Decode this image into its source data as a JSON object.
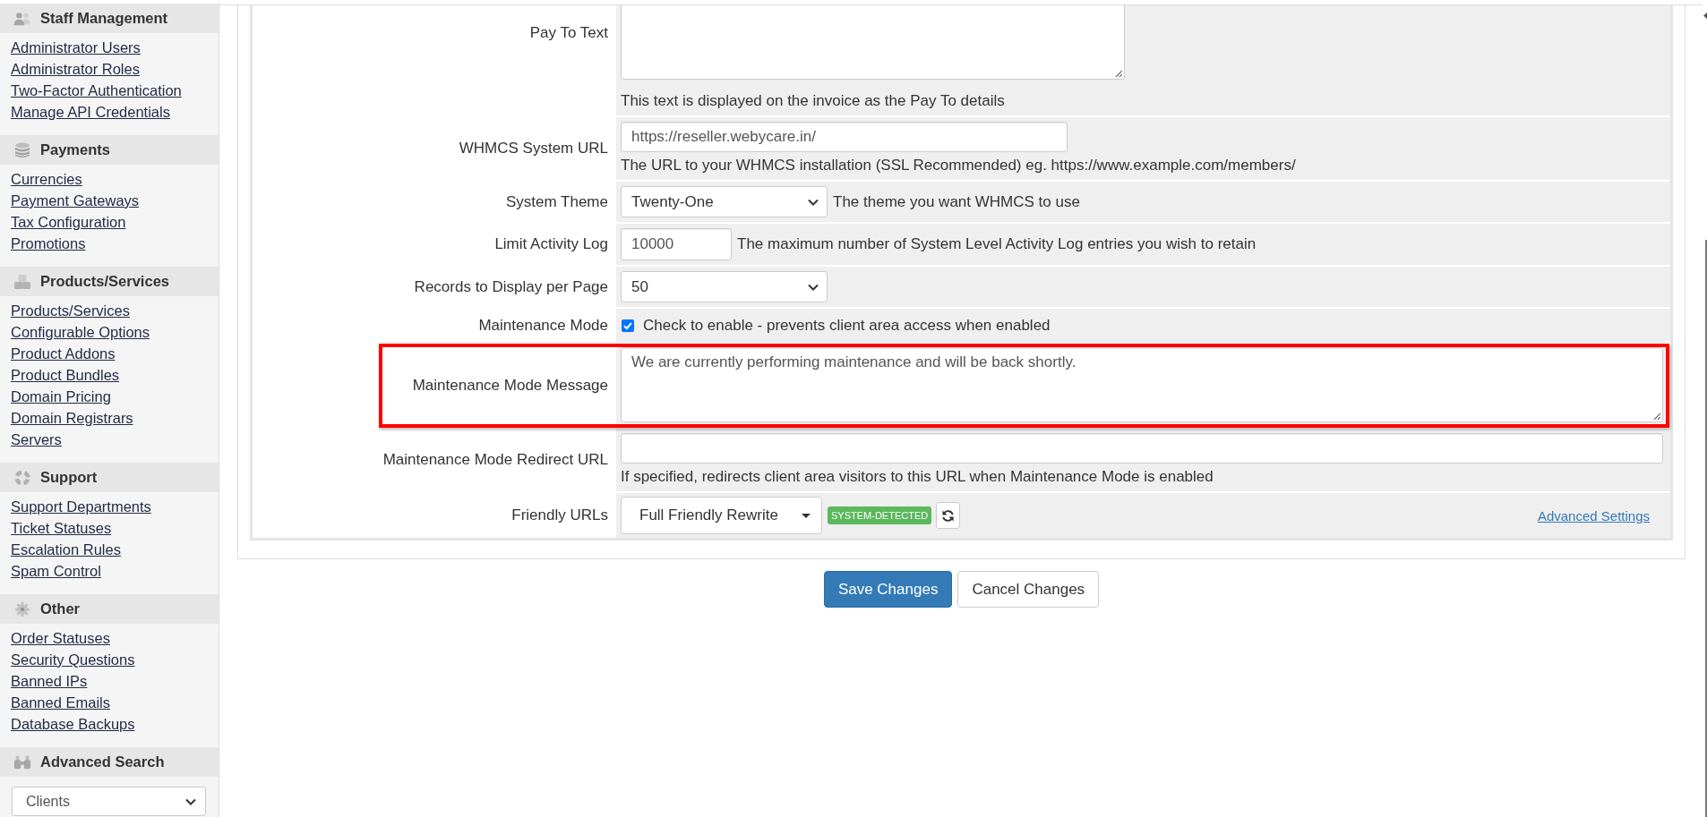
{
  "sidebar": {
    "sections": [
      {
        "title": "Staff Management",
        "links": [
          "Administrator Users",
          "Administrator Roles",
          "Two-Factor Authentication",
          "Manage API Credentials"
        ]
      },
      {
        "title": "Payments",
        "links": [
          "Currencies",
          "Payment Gateways",
          "Tax Configuration",
          "Promotions"
        ]
      },
      {
        "title": "Products/Services",
        "links": [
          "Products/Services",
          "Configurable Options",
          "Product Addons",
          "Product Bundles",
          "Domain Pricing",
          "Domain Registrars",
          "Servers"
        ]
      },
      {
        "title": "Support",
        "links": [
          "Support Departments",
          "Ticket Statuses",
          "Escalation Rules",
          "Spam Control"
        ]
      },
      {
        "title": "Other",
        "links": [
          "Order Statuses",
          "Security Questions",
          "Banned IPs",
          "Banned Emails",
          "Database Backups"
        ]
      }
    ],
    "search": {
      "title": "Advanced Search",
      "select": "Clients"
    }
  },
  "settings": [
    {
      "kind": "textarea",
      "label": "Pay To Text",
      "help": "This text is displayed on the invoice as the Pay To details",
      "highlighted": false
    },
    {
      "kind": "input",
      "label": "WHMCS System URL",
      "value": "https://reseller.webycare.in/",
      "help": "The URL to your WHMCS installation (SSL Recommended) eg. https://www.example.com/members/",
      "highlighted": false
    },
    {
      "kind": "select",
      "label": "System Theme",
      "value": "Twenty-One",
      "help": "The theme you want WHMCS to use",
      "highlighted": false
    },
    {
      "kind": "input",
      "label": "Limit Activity Log",
      "value": "10000",
      "help": "The maximum number of System Level Activity Log entries you wish to retain",
      "highlighted": false
    },
    {
      "kind": "select",
      "label": "Records to Display per Page",
      "value": "50",
      "highlighted": false
    },
    {
      "kind": "checkbox",
      "label": "Maintenance Mode",
      "checked": true,
      "caption": "Check to enable - prevents client area access when enabled",
      "highlighted": false
    },
    {
      "kind": "textarea",
      "label": "Maintenance Mode Message",
      "value": "We are currently performing maintenance and will be back shortly.",
      "highlighted": true
    },
    {
      "kind": "input",
      "label": "Maintenance Mode Redirect URL",
      "help": "If specified, redirects client area visitors to this URL when Maintenance Mode is enabled",
      "highlighted": false
    },
    {
      "kind": "menu",
      "label": "Friendly URLs",
      "value": "Full Friendly Rewrite",
      "badge": "SYSTEM-DETECTED",
      "link": "Advanced Settings",
      "highlighted": false
    }
  ],
  "buttons": [
    {
      "label": "Save Changes",
      "kind": "primary"
    },
    {
      "label": "Cancel Changes",
      "kind": "default"
    }
  ]
}
